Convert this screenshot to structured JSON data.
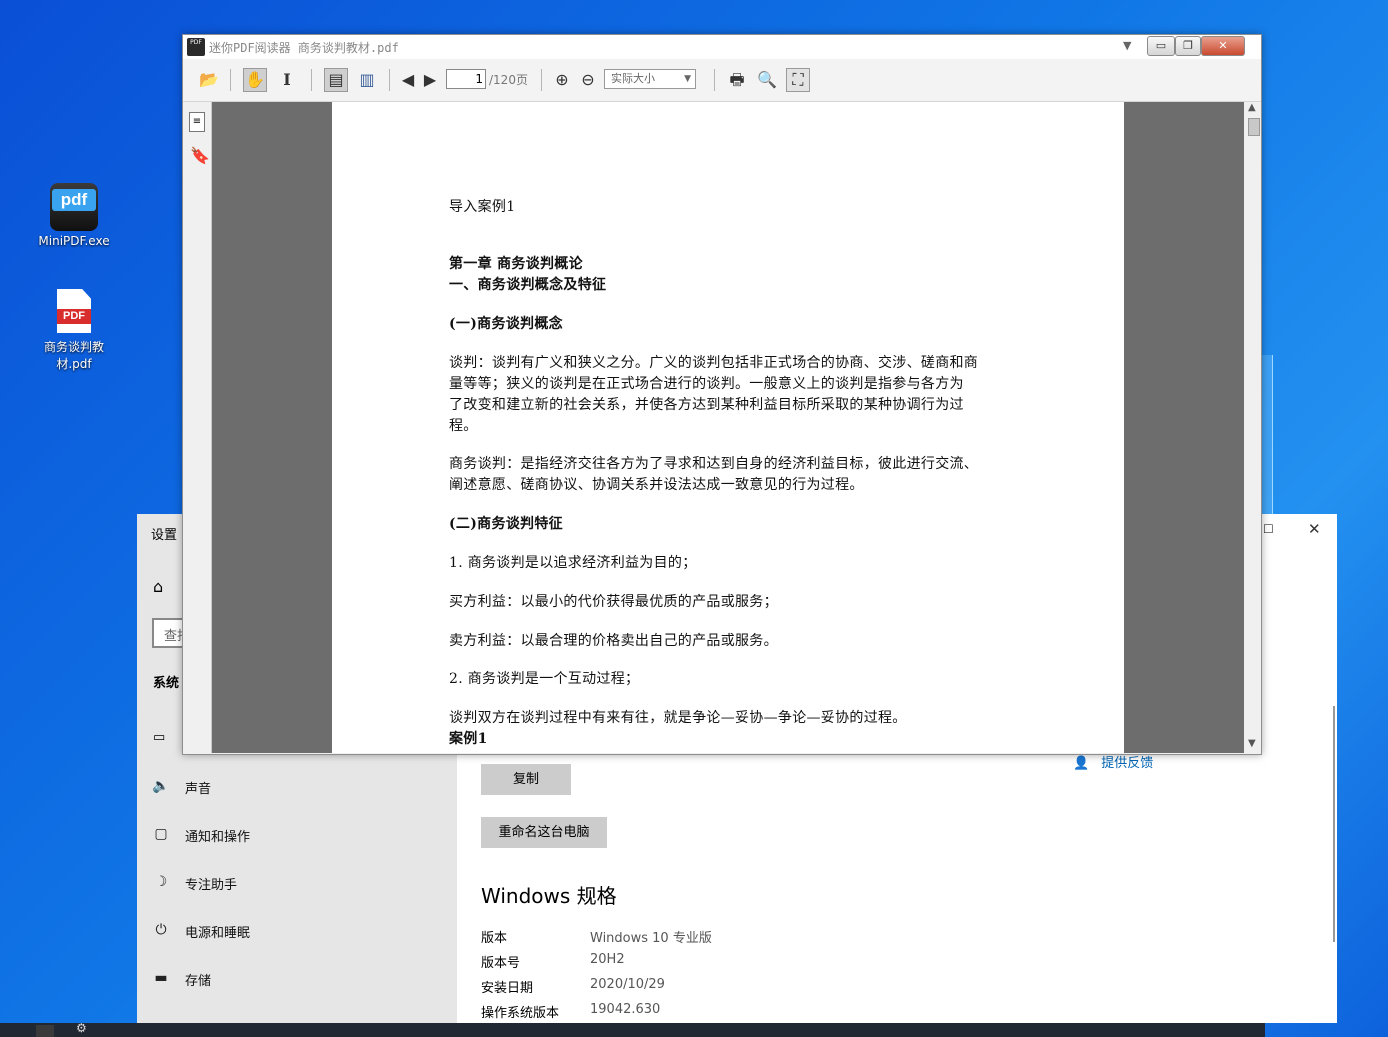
{
  "desktop": {
    "icons": [
      {
        "label": "MiniPDF.exe",
        "glyph": "pdf"
      },
      {
        "label": "商务谈判教材.pdf",
        "glyph": "PDF"
      }
    ]
  },
  "settings": {
    "title": "设置",
    "search_placeholder": "查找设置",
    "section": "系统",
    "nav": [
      {
        "label": "声音",
        "icon": "speaker-icon"
      },
      {
        "label": "通知和操作",
        "icon": "notification-icon"
      },
      {
        "label": "专注助手",
        "icon": "moon-icon"
      },
      {
        "label": "电源和睡眠",
        "icon": "power-icon"
      },
      {
        "label": "存储",
        "icon": "storage-icon"
      }
    ],
    "feedback": "提供反馈",
    "copy_button": "复制",
    "rename_button": "重命名这台电脑",
    "spec_title": "Windows 规格",
    "specs": [
      {
        "label": "版本",
        "value": "Windows 10 专业版"
      },
      {
        "label": "版本号",
        "value": "20H2"
      },
      {
        "label": "安装日期",
        "value": "2020/10/29"
      },
      {
        "label": "操作系统版本",
        "value": "19042.630"
      }
    ]
  },
  "pdf": {
    "window_title": "迷你PDF阅读器  商务谈判教材.pdf",
    "page_input": "1",
    "page_total": "/120页",
    "zoom_select": "实际大小",
    "lines": [
      "导入案例1",
      "第一章   商务谈判概论",
      "一、商务谈判概念及特征",
      "(一)商务谈判概念",
      "谈判：谈判有广义和狭义之分。广义的谈判包括非正式场合的协商、交涉、磋商和商",
      "量等等；狭义的谈判是在正式场合进行的谈判。一般意义上的谈判是指参与各方为",
      "了改变和建立新的社会关系，并使各方达到某种利益目标所采取的某种协调行为过",
      "程。",
      "商务谈判：是指经济交往各方为了寻求和达到自身的经济利益目标，彼此进行交流、",
      "阐述意愿、磋商协议、协调关系并设法达成一致意见的行为过程。",
      "(二)商务谈判特征",
      "1. 商务谈判是以追求经济利益为目的；",
      "买方利益：以最小的代价获得最优质的产品或服务；",
      "卖方利益：以最合理的价格卖出自己的产品或服务。",
      "2. 商务谈判是一个互动过程；",
      "谈判双方在谈判过程中有来有往，就是争论—妥协—争论—妥协的过程。",
      "案例1"
    ]
  }
}
